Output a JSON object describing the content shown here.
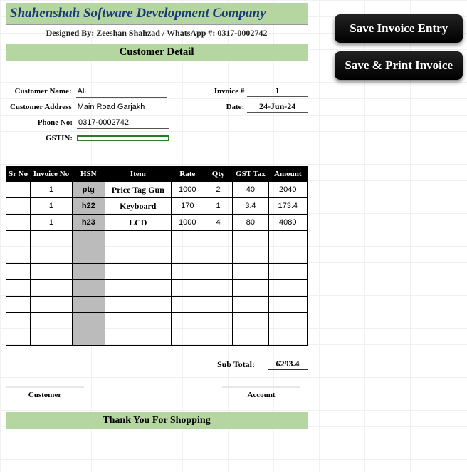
{
  "header": {
    "company": "Shahenshah Software Development Company",
    "designed_by": "Designed By: Zeeshan Shahzad / WhatsApp #: 0317-0002742",
    "customer_detail": "Customer Detail"
  },
  "buttons": {
    "save_entry": "Save Invoice Entry",
    "save_print": "Save & Print Invoice"
  },
  "customer": {
    "name_label": "Customer Name:",
    "name": "Ali",
    "address_label": "Customer Address",
    "address": "Main Road Garjakh",
    "phone_label": "Phone No:",
    "phone": "0317-0002742",
    "gstin_label": "GSTIN:",
    "gstin": ""
  },
  "invoice_meta": {
    "invoice_label": "Invoice #",
    "invoice_no": "1",
    "date_label": "Date:",
    "date": "24-Jun-24"
  },
  "columns": {
    "srno": "Sr No",
    "invno": "Invoice No",
    "hsn": "HSN",
    "item": "Item",
    "rate": "Rate",
    "qty": "Qty",
    "gst": "GST Tax",
    "amount": "Amount"
  },
  "rows": [
    {
      "srno": "",
      "invno": "1",
      "hsn": "ptg",
      "item": "Price Tag Gun",
      "rate": "1000",
      "qty": "2",
      "gst": "40",
      "amount": "2040"
    },
    {
      "srno": "",
      "invno": "1",
      "hsn": "h22",
      "item": "Keyboard",
      "rate": "170",
      "qty": "1",
      "gst": "3.4",
      "amount": "173.4"
    },
    {
      "srno": "",
      "invno": "1",
      "hsn": "h23",
      "item": "LCD",
      "rate": "1000",
      "qty": "4",
      "gst": "80",
      "amount": "4080"
    }
  ],
  "empty_rows": 7,
  "subtotal": {
    "label": "Sub Total:",
    "value": "6293.4"
  },
  "signatures": {
    "customer": "Customer",
    "account": "Account"
  },
  "thanks": "Thank You For Shopping"
}
